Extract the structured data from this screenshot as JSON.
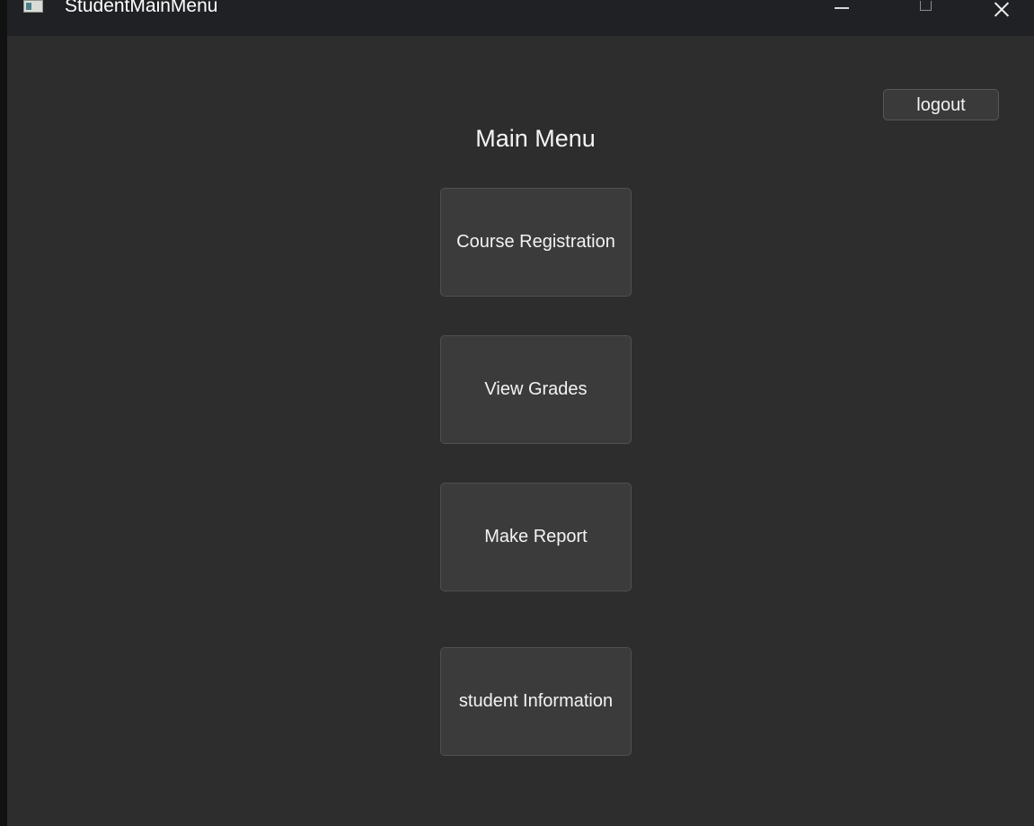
{
  "window": {
    "title": "StudentMainMenu",
    "controls": {
      "minimize_icon": "minimize-icon",
      "maximize_icon": "maximize-icon",
      "close_icon": "close-icon"
    }
  },
  "main": {
    "logout_label": "logout",
    "title": "Main Menu",
    "buttons": [
      {
        "label": "Course Registration"
      },
      {
        "label": "View Grades"
      },
      {
        "label": "Make Report"
      },
      {
        "label": "student Information"
      }
    ]
  },
  "colors": {
    "background": "#2d2d2d",
    "titlebar": "#1f2124",
    "button": "#3b3b3b",
    "text": "#f3f3f3"
  }
}
